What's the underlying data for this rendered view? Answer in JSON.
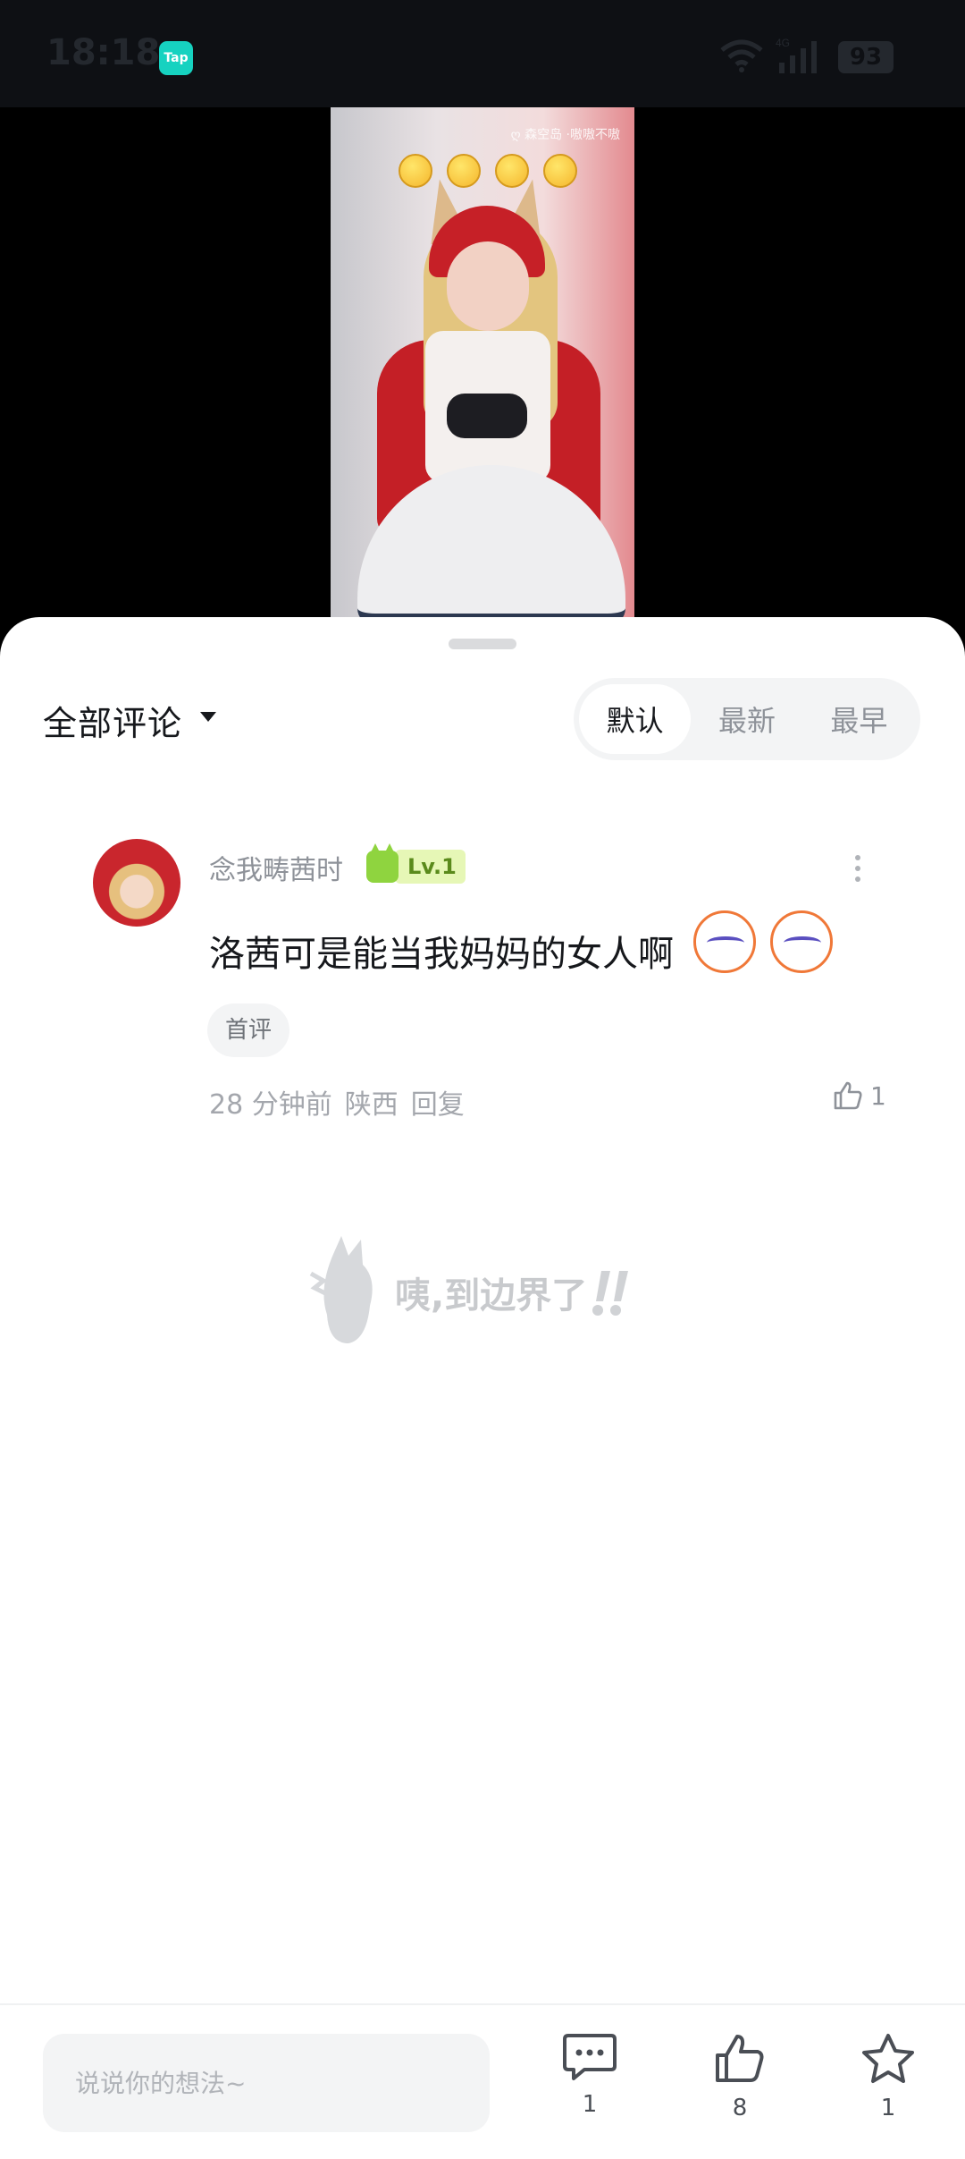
{
  "status_bar": {
    "time": "18:18",
    "app_icon_label": "Tap",
    "network": "4G",
    "battery": "93"
  },
  "video": {
    "watermark": "ღ 森空岛 ·嗷嗷不嗷"
  },
  "comments": {
    "title": "全部评论",
    "sort_tabs": [
      "默认",
      "最新",
      "最早"
    ],
    "active_tab": "默认"
  },
  "comment": {
    "username": "念我畴茜时",
    "level": "Lv.1",
    "text": "洛茜可是能当我妈妈的女人啊",
    "tag": "首评",
    "time": "28 分钟前",
    "location": "陕西",
    "reply_label": "回复",
    "likes": "1"
  },
  "end_marker": {
    "text": "咦,到边界了"
  },
  "bottom_bar": {
    "input_placeholder": "说说你的想法~",
    "comment_count": "1",
    "like_count": "8",
    "favorite_count": "1"
  },
  "colors": {
    "tap_brand": "#16d2c0",
    "level_green": "#8fd43f",
    "sheet_bg": "#ffffff",
    "text_primary": "#16181c",
    "text_secondary": "#8e9299"
  }
}
